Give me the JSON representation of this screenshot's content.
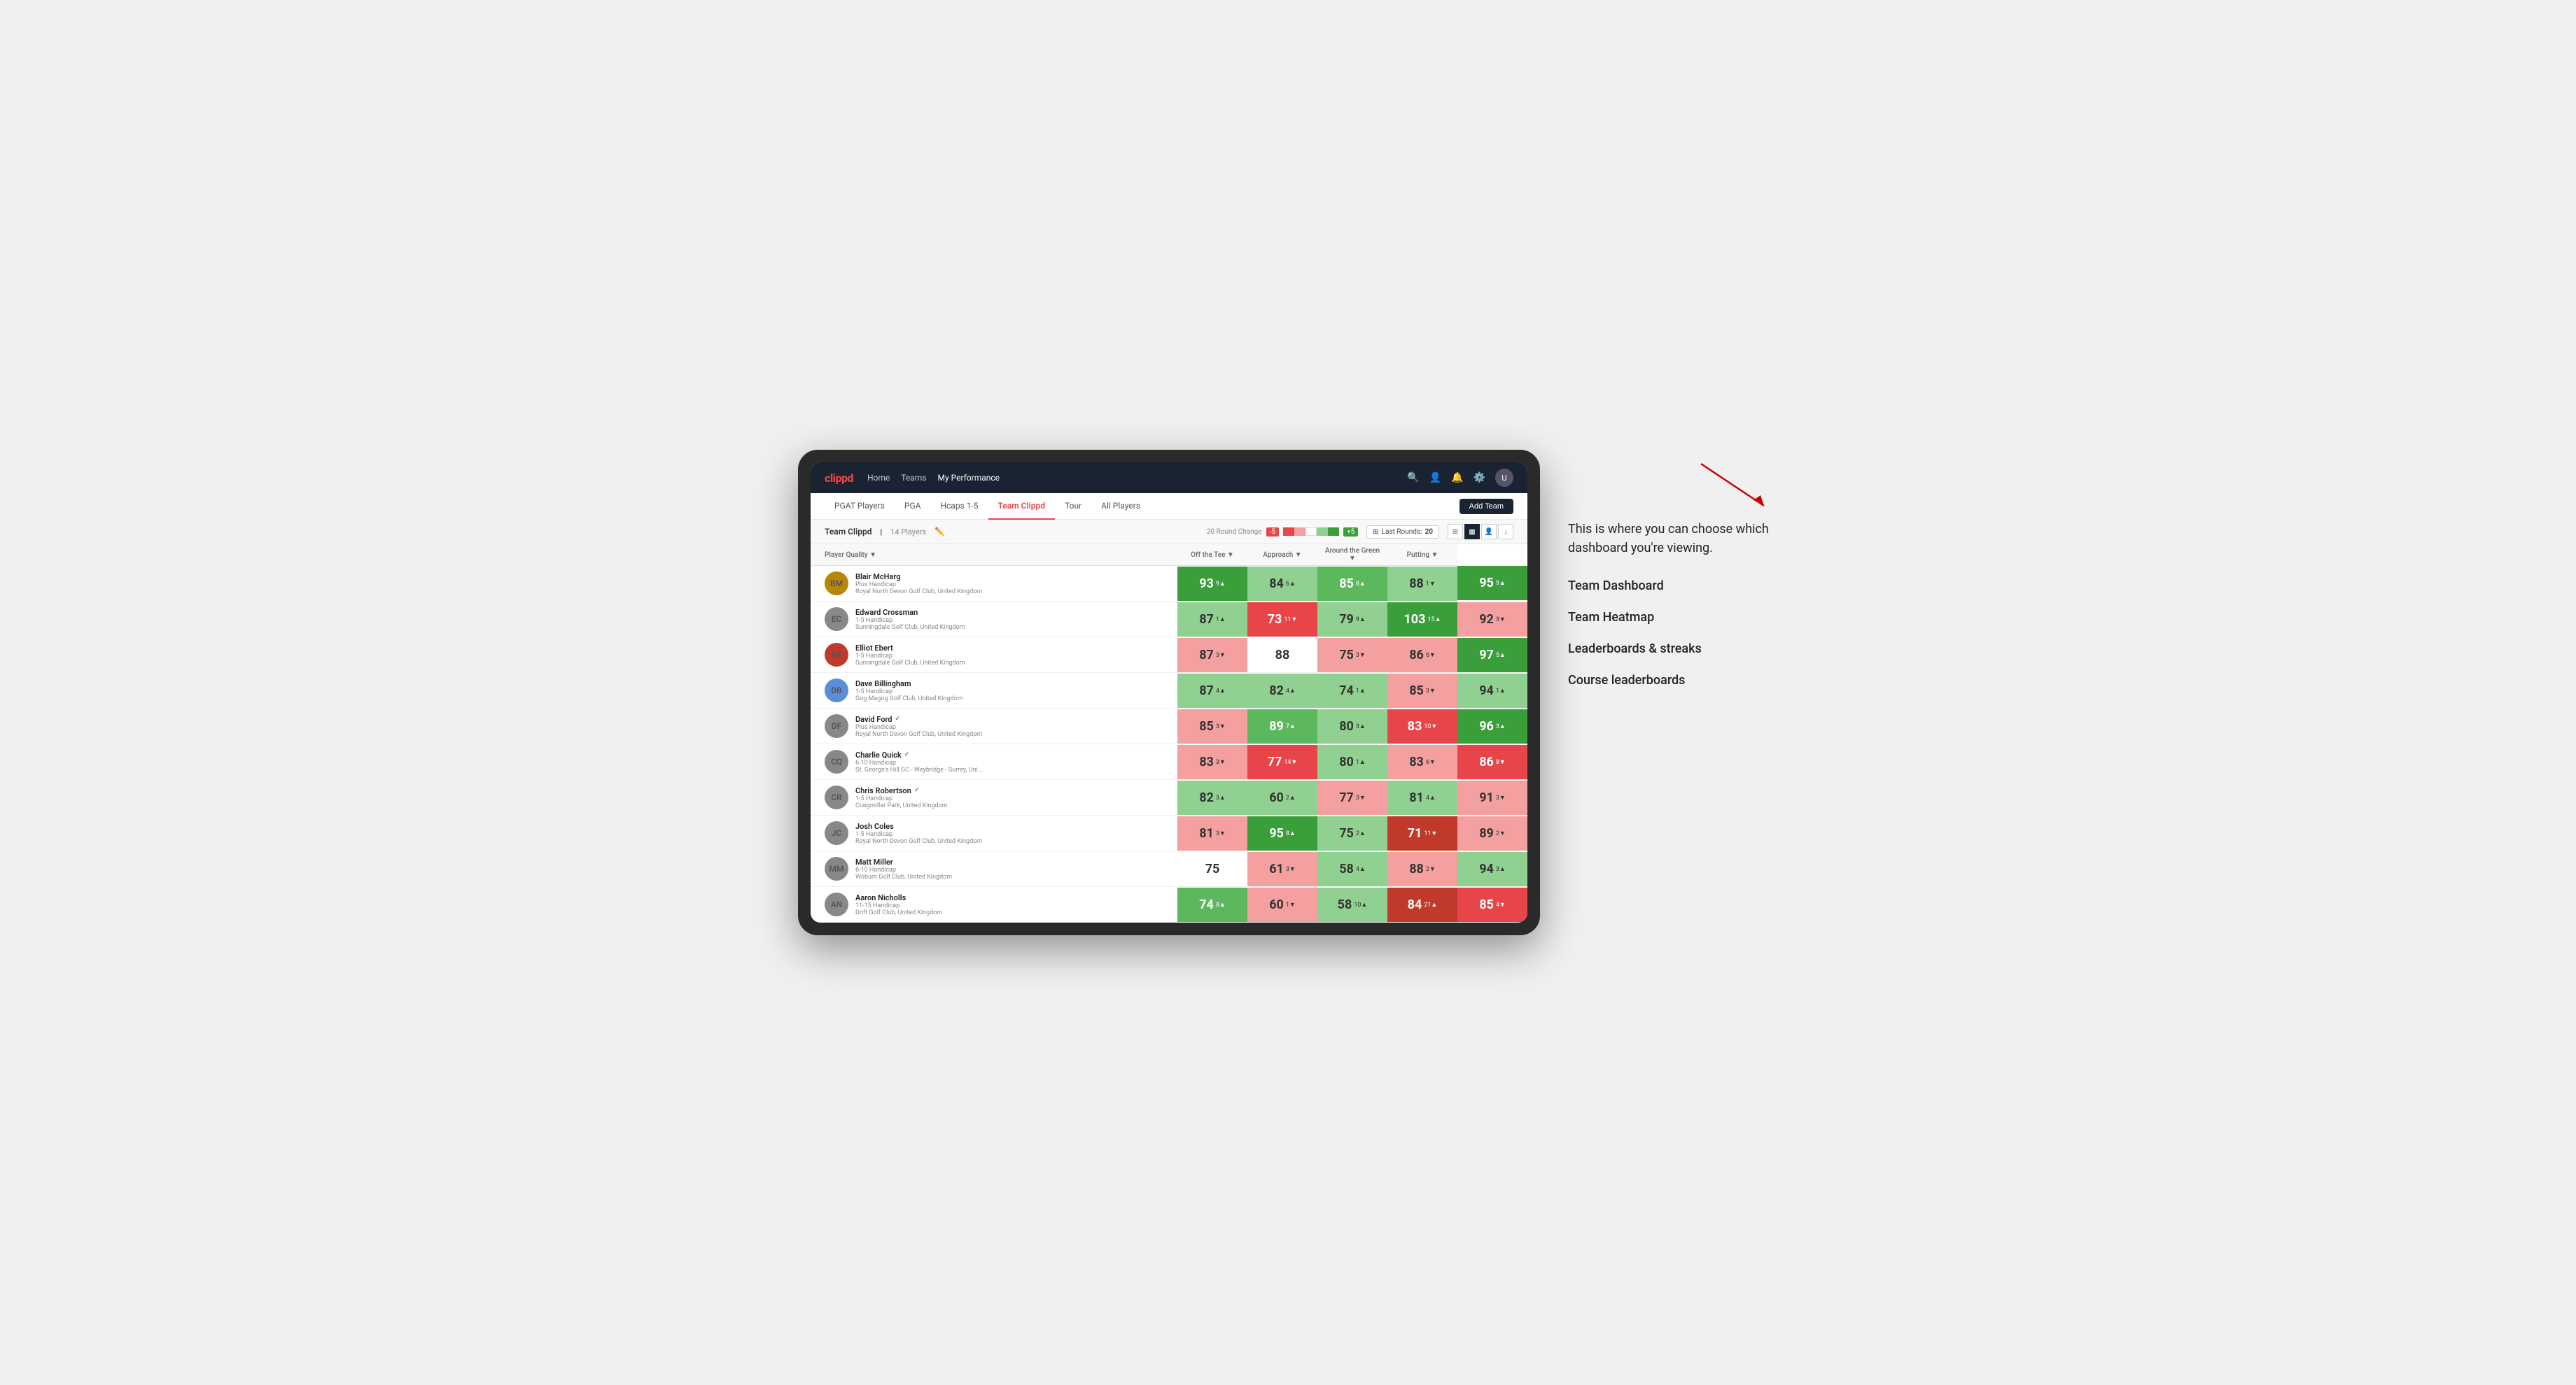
{
  "logo": "clippd",
  "nav": {
    "links": [
      "Home",
      "Teams",
      "My Performance"
    ],
    "icons": [
      "search",
      "user",
      "bell",
      "settings"
    ],
    "avatar": "U"
  },
  "sub_nav": {
    "items": [
      "PGAT Players",
      "PGA",
      "Hcaps 1-5",
      "Team Clippd",
      "Tour",
      "All Players"
    ],
    "active": "Team Clippd",
    "add_button": "Add Team"
  },
  "team_header": {
    "name": "Team Clippd",
    "separator": "|",
    "count": "14 Players",
    "round_change_label": "20 Round Change",
    "neg_label": "-5",
    "pos_label": "+5",
    "last_rounds_label": "Last Rounds:",
    "last_rounds_value": "20"
  },
  "table": {
    "columns": [
      "Player Quality ▼",
      "Off the Tee ▼",
      "Approach ▼",
      "Around the Green ▼",
      "Putting ▼"
    ],
    "rows": [
      {
        "name": "Blair McHarg",
        "hcp": "Plus Handicap",
        "club": "Royal North Devon Golf Club, United Kingdom",
        "avatar_initials": "BM",
        "avatar_color": "#b8860b",
        "scores": [
          {
            "value": "93",
            "change": "9",
            "dir": "up",
            "color": "green-dark"
          },
          {
            "value": "84",
            "change": "6",
            "dir": "up",
            "color": "green-light"
          },
          {
            "value": "85",
            "change": "8",
            "dir": "up",
            "color": "green-med"
          },
          {
            "value": "88",
            "change": "1",
            "dir": "down",
            "color": "green-light"
          },
          {
            "value": "95",
            "change": "9",
            "dir": "up",
            "color": "green-dark"
          }
        ]
      },
      {
        "name": "Edward Crossman",
        "hcp": "1-5 Handicap",
        "club": "Sunningdale Golf Club, United Kingdom",
        "avatar_initials": "EC",
        "avatar_color": "#888",
        "scores": [
          {
            "value": "87",
            "change": "1",
            "dir": "up",
            "color": "green-light"
          },
          {
            "value": "73",
            "change": "11",
            "dir": "down",
            "color": "red-med"
          },
          {
            "value": "79",
            "change": "9",
            "dir": "up",
            "color": "green-light"
          },
          {
            "value": "103",
            "change": "15",
            "dir": "up",
            "color": "green-dark"
          },
          {
            "value": "92",
            "change": "3",
            "dir": "down",
            "color": "red-light"
          }
        ]
      },
      {
        "name": "Elliot Ebert",
        "hcp": "1-5 Handicap",
        "club": "Sunningdale Golf Club, United Kingdom",
        "avatar_initials": "EE",
        "avatar_color": "#c0392b",
        "scores": [
          {
            "value": "87",
            "change": "3",
            "dir": "down",
            "color": "red-light"
          },
          {
            "value": "88",
            "change": "",
            "dir": "",
            "color": "white"
          },
          {
            "value": "75",
            "change": "3",
            "dir": "down",
            "color": "red-light"
          },
          {
            "value": "86",
            "change": "6",
            "dir": "down",
            "color": "red-light"
          },
          {
            "value": "97",
            "change": "5",
            "dir": "up",
            "color": "green-dark"
          }
        ]
      },
      {
        "name": "Dave Billingham",
        "hcp": "1-5 Handicap",
        "club": "Gog Magog Golf Club, United Kingdom",
        "avatar_initials": "DB",
        "avatar_color": "#5b8dd9",
        "scores": [
          {
            "value": "87",
            "change": "4",
            "dir": "up",
            "color": "green-light"
          },
          {
            "value": "82",
            "change": "4",
            "dir": "up",
            "color": "green-light"
          },
          {
            "value": "74",
            "change": "1",
            "dir": "up",
            "color": "green-light"
          },
          {
            "value": "85",
            "change": "3",
            "dir": "down",
            "color": "red-light"
          },
          {
            "value": "94",
            "change": "1",
            "dir": "up",
            "color": "green-light"
          }
        ]
      },
      {
        "name": "David Ford",
        "hcp": "Plus Handicap",
        "club": "Royal North Devon Golf Club, United Kingdom",
        "avatar_initials": "DF",
        "avatar_color": "#888",
        "verified": true,
        "scores": [
          {
            "value": "85",
            "change": "3",
            "dir": "down",
            "color": "red-light"
          },
          {
            "value": "89",
            "change": "7",
            "dir": "up",
            "color": "green-med"
          },
          {
            "value": "80",
            "change": "3",
            "dir": "up",
            "color": "green-light"
          },
          {
            "value": "83",
            "change": "10",
            "dir": "down",
            "color": "red-med"
          },
          {
            "value": "96",
            "change": "3",
            "dir": "up",
            "color": "green-dark"
          }
        ]
      },
      {
        "name": "Charlie Quick",
        "hcp": "6-10 Handicap",
        "club": "St. George's Hill GC - Weybridge - Surrey, Uni...",
        "avatar_initials": "CQ",
        "avatar_color": "#888",
        "verified": true,
        "scores": [
          {
            "value": "83",
            "change": "3",
            "dir": "down",
            "color": "red-light"
          },
          {
            "value": "77",
            "change": "14",
            "dir": "down",
            "color": "red-med"
          },
          {
            "value": "80",
            "change": "1",
            "dir": "up",
            "color": "green-light"
          },
          {
            "value": "83",
            "change": "6",
            "dir": "down",
            "color": "red-light"
          },
          {
            "value": "86",
            "change": "8",
            "dir": "down",
            "color": "red-med"
          }
        ]
      },
      {
        "name": "Chris Robertson",
        "hcp": "1-5 Handicap",
        "club": "Craigmillar Park, United Kingdom",
        "avatar_initials": "CR",
        "avatar_color": "#888",
        "verified": true,
        "scores": [
          {
            "value": "82",
            "change": "3",
            "dir": "up",
            "color": "green-light"
          },
          {
            "value": "60",
            "change": "2",
            "dir": "up",
            "color": "green-light"
          },
          {
            "value": "77",
            "change": "3",
            "dir": "down",
            "color": "red-light"
          },
          {
            "value": "81",
            "change": "4",
            "dir": "up",
            "color": "green-light"
          },
          {
            "value": "91",
            "change": "3",
            "dir": "down",
            "color": "red-light"
          }
        ]
      },
      {
        "name": "Josh Coles",
        "hcp": "1-5 Handicap",
        "club": "Royal North Devon Golf Club, United Kingdom",
        "avatar_initials": "JC",
        "avatar_color": "#888",
        "scores": [
          {
            "value": "81",
            "change": "3",
            "dir": "down",
            "color": "red-light"
          },
          {
            "value": "95",
            "change": "8",
            "dir": "up",
            "color": "green-dark"
          },
          {
            "value": "75",
            "change": "2",
            "dir": "up",
            "color": "green-light"
          },
          {
            "value": "71",
            "change": "11",
            "dir": "down",
            "color": "red-dark"
          },
          {
            "value": "89",
            "change": "2",
            "dir": "down",
            "color": "red-light"
          }
        ]
      },
      {
        "name": "Matt Miller",
        "hcp": "6-10 Handicap",
        "club": "Woburn Golf Club, United Kingdom",
        "avatar_initials": "MM",
        "avatar_color": "#888",
        "scores": [
          {
            "value": "75",
            "change": "",
            "dir": "",
            "color": "white"
          },
          {
            "value": "61",
            "change": "3",
            "dir": "down",
            "color": "red-light"
          },
          {
            "value": "58",
            "change": "4",
            "dir": "up",
            "color": "green-light"
          },
          {
            "value": "88",
            "change": "2",
            "dir": "down",
            "color": "red-light"
          },
          {
            "value": "94",
            "change": "3",
            "dir": "up",
            "color": "green-light"
          }
        ]
      },
      {
        "name": "Aaron Nicholls",
        "hcp": "11-15 Handicap",
        "club": "Drift Golf Club, United Kingdom",
        "avatar_initials": "AN",
        "avatar_color": "#888",
        "scores": [
          {
            "value": "74",
            "change": "8",
            "dir": "up",
            "color": "green-med"
          },
          {
            "value": "60",
            "change": "1",
            "dir": "down",
            "color": "red-light"
          },
          {
            "value": "58",
            "change": "10",
            "dir": "up",
            "color": "green-light"
          },
          {
            "value": "84",
            "change": "21",
            "dir": "up",
            "color": "red-dark"
          },
          {
            "value": "85",
            "change": "4",
            "dir": "down",
            "color": "red-med"
          }
        ]
      }
    ]
  },
  "annotation": {
    "intro_text": "This is where you can choose which dashboard you're viewing.",
    "items": [
      "Team Dashboard",
      "Team Heatmap",
      "Leaderboards & streaks",
      "Course leaderboards"
    ]
  }
}
